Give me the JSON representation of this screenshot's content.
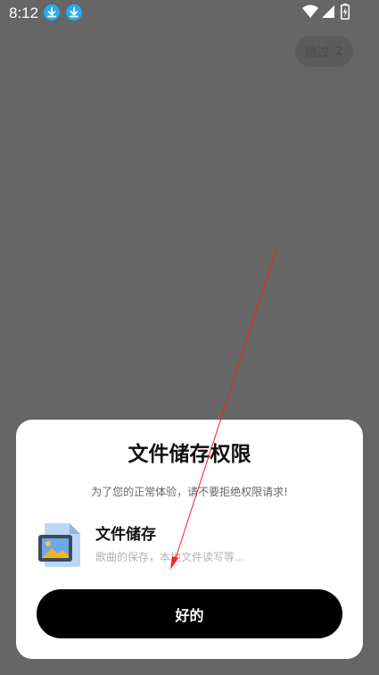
{
  "status_bar": {
    "time": "8:12",
    "icons": [
      "download-icon",
      "download-icon",
      "wifi-icon",
      "signal-icon",
      "battery-icon"
    ]
  },
  "skip": {
    "label": "跳过",
    "countdown": "2"
  },
  "dialog": {
    "title": "文件储存权限",
    "subtitle": "为了您的正常体验，请不要拒绝权限请求!",
    "permission": {
      "icon": "image-file-icon",
      "title": "文件储存",
      "description": "歌曲的保存，本地文件读写等..."
    },
    "ok_label": "好的"
  },
  "colors": {
    "overlay": "#666666",
    "dialog_bg": "#ffffff",
    "button_bg": "#000000",
    "accent_download": "#29a9f0",
    "annotation": "#ff0000"
  }
}
